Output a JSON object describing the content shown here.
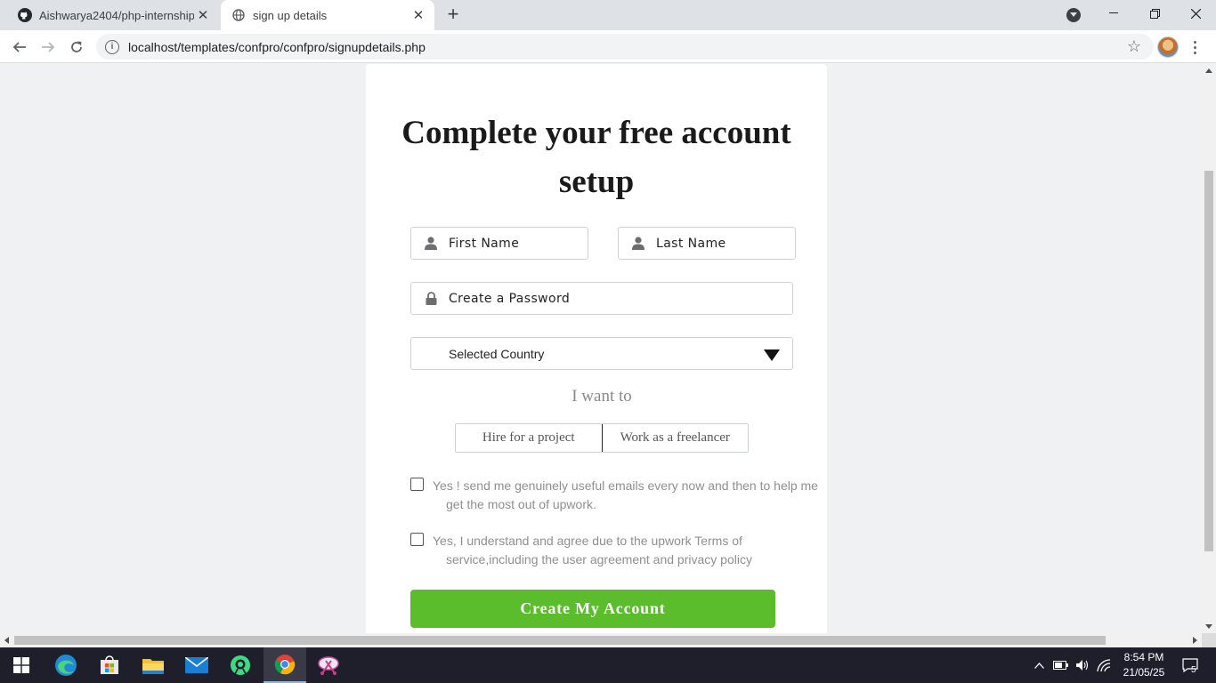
{
  "browser": {
    "tabs": [
      {
        "title": "Aishwarya2404/php-internship",
        "icon": "github-icon",
        "active": false
      },
      {
        "title": "sign up details",
        "icon": "globe-icon",
        "active": true
      }
    ],
    "url": "localhost/templates/confpro/confpro/signupdetails.php"
  },
  "form": {
    "heading_line1": "Complete your free account",
    "heading_line2": "setup",
    "first_name_placeholder": "First Name",
    "last_name_placeholder": "Last Name",
    "password_placeholder": "Create a Password",
    "country_selected": "Selected Country",
    "intent_label": "I want to",
    "intent_options": [
      "Hire for a project",
      "Work as a freelancer"
    ],
    "email_consent_line1": "Yes ! send me genuinely useful emails every now and then to help me",
    "email_consent_line2": "get the most out of upwork.",
    "terms_line1": "Yes, I understand and agree due to the upwork Terms of",
    "terms_line2": "service,including the user agreement and privacy policy",
    "submit_label": "Create My Account",
    "submit_color": "#5bbd2b"
  },
  "taskbar": {
    "apps": [
      "windows-start-icon",
      "edge-icon",
      "store-icon",
      "file-explorer-icon",
      "mail-icon",
      "android-studio-icon",
      "chrome-icon",
      "snipping-tool-icon"
    ],
    "time": "8:54 PM",
    "date": "21/05/25",
    "notification_count": "5"
  }
}
